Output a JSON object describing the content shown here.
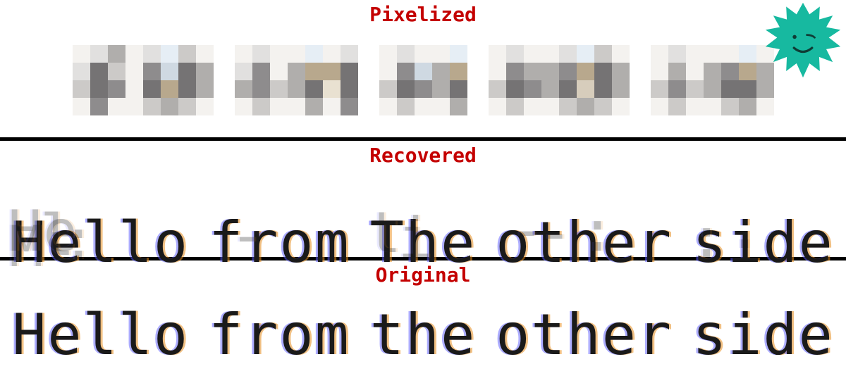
{
  "panels": {
    "pixelized": {
      "title": "Pixelized"
    },
    "recovered": {
      "title": "Recovered",
      "words": [
        "Hello",
        "from",
        "the",
        "other",
        "side"
      ],
      "garbled_display": [
        "Hello",
        "from",
        "The",
        "other",
        "side"
      ]
    },
    "original": {
      "title": "Original",
      "words": [
        "Hello",
        "from",
        "the",
        "other",
        "side"
      ]
    }
  },
  "pixel_words": [
    {
      "cols": 8,
      "grid": [
        "0",
        "1",
        "2",
        "0",
        "1",
        "5",
        "5",
        "4",
        "3",
        "2",
        "4",
        "0",
        "0",
        "0",
        "0",
        "0",
        "1",
        "4",
        "5",
        "2",
        "6",
        "7",
        "8",
        "3",
        "2",
        "5",
        "5",
        "2",
        "0",
        "3",
        "3",
        "0",
        "1",
        "3",
        "5",
        "3",
        "0",
        "3",
        "4",
        "0",
        "7",
        "8",
        "9",
        "6",
        "0",
        "4",
        "4",
        "1",
        "1",
        "5",
        "5",
        "4",
        "0",
        "3",
        "3",
        "0",
        "0",
        "4",
        "4",
        "0",
        "6",
        "4",
        "4",
        "1"
      ]
    },
    {
      "cols": 7,
      "grid": [
        "0",
        "1",
        "3",
        "0",
        "1",
        "4",
        "4",
        "2",
        "0",
        "0",
        "2",
        "0",
        "0",
        "3",
        "3",
        "0",
        "6",
        "8",
        "5",
        "3",
        "0",
        "8",
        "a",
        "0",
        "1",
        "5",
        "5",
        "4",
        "0",
        "7",
        "4",
        "0",
        "0",
        "3",
        "5",
        "2",
        "9",
        "a",
        "b",
        "6",
        "0",
        "3",
        "3",
        "0",
        "0",
        "4",
        "4",
        "0",
        "0",
        "3",
        "4",
        "0",
        "0",
        "0",
        "0",
        "0",
        "0",
        "0",
        "0",
        "0",
        "0",
        "0",
        "0",
        "0"
      ]
    },
    {
      "cols": 5,
      "grid": [
        "0",
        "0",
        "2",
        "0",
        "1",
        "4",
        "5",
        "2",
        "0",
        "7",
        "4",
        "0",
        "0",
        "3",
        "3",
        "0",
        "6",
        "8",
        "5",
        "3",
        "0",
        "8",
        "a",
        "0",
        "1",
        "5",
        "5",
        "4",
        "0",
        "0",
        "0",
        "0",
        "0",
        "3",
        "5",
        "2",
        "9",
        "a",
        "b",
        "6",
        "0",
        "3",
        "3",
        "0",
        "0",
        "0",
        "0",
        "0",
        "0",
        "0",
        "0",
        "0",
        "0",
        "0",
        "0",
        "0",
        "0",
        "0",
        "0",
        "0",
        "0",
        "0",
        "0",
        "0"
      ]
    },
    {
      "cols": 8,
      "grid": [
        "0",
        "0",
        "2",
        "0",
        "1",
        "4",
        "5",
        "2",
        "0",
        "3",
        "4",
        "0",
        "0",
        "3",
        "3",
        "0",
        "1",
        "4",
        "5",
        "2",
        "6",
        "8",
        "9",
        "3",
        "2",
        "5",
        "5",
        "2",
        "0",
        "3",
        "3",
        "0",
        "1",
        "3",
        "5",
        "3",
        "0",
        "8",
        "a",
        "0",
        "7",
        "8",
        "9",
        "6",
        "0",
        "4",
        "4",
        "1",
        "6",
        "5",
        "5",
        "4",
        "0",
        "3",
        "3",
        "0",
        "0",
        "4",
        "4",
        "0",
        "0",
        "3",
        "3",
        "1"
      ]
    },
    {
      "cols": 7,
      "grid": [
        "0",
        "0",
        "2",
        "0",
        "1",
        "3",
        "4",
        "2",
        "0",
        "0",
        "2",
        "0",
        "0",
        "3",
        "3",
        "0",
        "0",
        "4",
        "5",
        "2",
        "6",
        "8",
        "5",
        "3",
        "0",
        "3",
        "3",
        "0",
        "1",
        "5",
        "5",
        "4",
        "6",
        "8",
        "9",
        "3",
        "0",
        "8",
        "a",
        "0",
        "7",
        "4",
        "5",
        "2",
        "0",
        "3",
        "3",
        "0",
        "0",
        "4",
        "4",
        "0",
        "9",
        "a",
        "b",
        "6",
        "0",
        "0",
        "0",
        "0",
        "0",
        "0",
        "0",
        "0"
      ]
    }
  ],
  "mascot": {
    "name": "depixel-starburst-mascot",
    "color": "#17b9a0"
  }
}
